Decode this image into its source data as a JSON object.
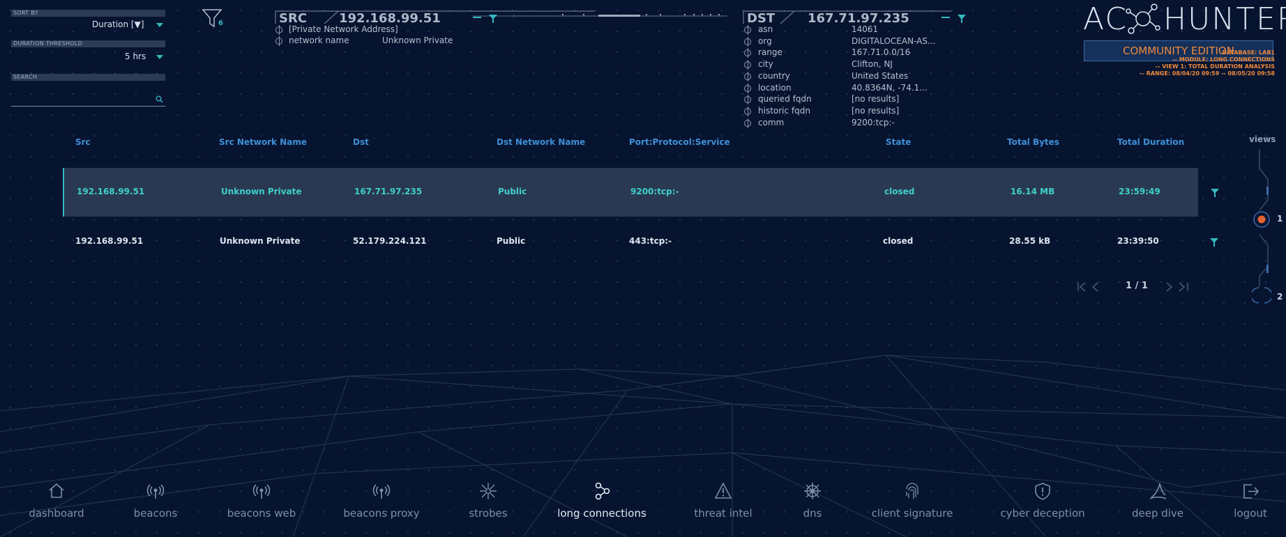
{
  "controls": {
    "sort_by_label": "SORT BY",
    "sort_by_value": "Duration [▼]",
    "duration_threshold_label": "DURATION THRESHOLD",
    "duration_threshold_value": "5 hrs",
    "search_label": "SEARCH",
    "search_value": "",
    "filter_count": "6"
  },
  "src_panel": {
    "title": "SRC",
    "ip": "192.168.99.51",
    "rows": [
      {
        "key": "[Private Network Address]",
        "value": ""
      },
      {
        "key": "network name",
        "value": "Unknown Private"
      }
    ]
  },
  "dst_panel": {
    "title": "DST",
    "ip": "167.71.97.235",
    "rows": [
      {
        "key": "asn",
        "value": "14061"
      },
      {
        "key": "org",
        "value": "DIGITALOCEAN-AS..."
      },
      {
        "key": "range",
        "value": "167.71.0.0/16"
      },
      {
        "key": "city",
        "value": "Clifton, NJ"
      },
      {
        "key": "country",
        "value": "United States"
      },
      {
        "key": "location",
        "value": "40.8364N, -74.1..."
      },
      {
        "key": "queried fqdn",
        "value": "[no results]"
      },
      {
        "key": "historic fqdn",
        "value": "[no results]"
      },
      {
        "key": "comm",
        "value": "9200:tcp:-"
      }
    ]
  },
  "brand": {
    "logo_left": "AC",
    "logo_right": "HUNTER",
    "edition": "COMMUNITY EDITION",
    "database": "DATABASE: LAB1",
    "module": "-- MODULE: LONG CONNECTIONS",
    "view": "-- VIEW 1: TOTAL DURATION ANALYSIS",
    "range": "-- RANGE: 08/04/20 09:59 -- 08/05/20 09:58",
    "accent_color": "#f08a3c"
  },
  "table": {
    "headers": [
      "Src",
      "Src Network Name",
      "Dst",
      "Dst Network Name",
      "Port:Protocol:Service",
      "State",
      "Total Bytes",
      "Total Duration"
    ],
    "rows": [
      [
        "192.168.99.51",
        "Unknown Private",
        "167.71.97.235",
        "Public",
        "9200:tcp:-",
        "closed",
        "16.14 MB",
        "23:59:49"
      ],
      [
        "192.168.99.51",
        "Unknown Private",
        "52.179.224.121",
        "Public",
        "443:tcp:-",
        "closed",
        "28.55 kB",
        "23:39:50"
      ]
    ],
    "pagination": "1 / 1"
  },
  "views": {
    "label": "views",
    "items": [
      "1",
      "2"
    ]
  },
  "nav": [
    {
      "label": "dashboard",
      "icon": "home-icon"
    },
    {
      "label": "beacons",
      "icon": "beacon-icon"
    },
    {
      "label": "beacons web",
      "icon": "beacon-web-icon"
    },
    {
      "label": "beacons proxy",
      "icon": "beacon-proxy-icon"
    },
    {
      "label": "strobes",
      "icon": "strobe-icon"
    },
    {
      "label": "long connections",
      "icon": "long-connections-icon"
    },
    {
      "label": "threat intel",
      "icon": "warning-icon"
    },
    {
      "label": "dns",
      "icon": "dns-wheel-icon"
    },
    {
      "label": "client signature",
      "icon": "fingerprint-icon"
    },
    {
      "label": "cyber deception",
      "icon": "shield-icon"
    },
    {
      "label": "deep dive",
      "icon": "fin-icon"
    },
    {
      "label": "logout",
      "icon": "logout-icon"
    }
  ]
}
